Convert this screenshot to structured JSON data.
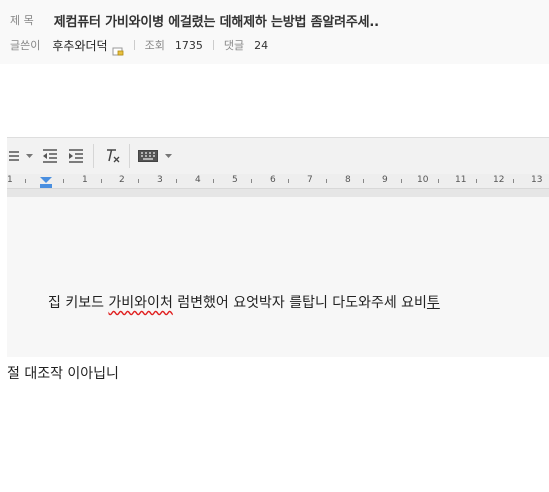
{
  "post": {
    "title_label": "제 목",
    "title": "제컴퓨터 가비와이병 에걸렸는 데해제하 는방법 좀알려주세..",
    "author_label": "글쓴이",
    "author": "후추와더덕",
    "views_label": "조회",
    "views": "1735",
    "comments_label": "댓글",
    "comments": "24"
  },
  "toolbar": {
    "icons": [
      "list-icon",
      "dropdown-arrow-icon",
      "outdent-icon",
      "indent-icon",
      "clear-format-icon",
      "keyboard-icon",
      "dropdown-arrow-icon"
    ]
  },
  "ruler": {
    "numbers": [
      "1",
      "1",
      "2",
      "3",
      "4",
      "5",
      "6",
      "7",
      "8",
      "9",
      "10",
      "11",
      "12",
      "13"
    ]
  },
  "editor": {
    "text_before": "집 키보드 ",
    "text_misspelled": "가비와이처",
    "text_after": " 럼변했어 요엇박자 를탑니 다도와주세 요비",
    "text_cursor": "투"
  },
  "below_text": "절 대조작 이아닙니"
}
